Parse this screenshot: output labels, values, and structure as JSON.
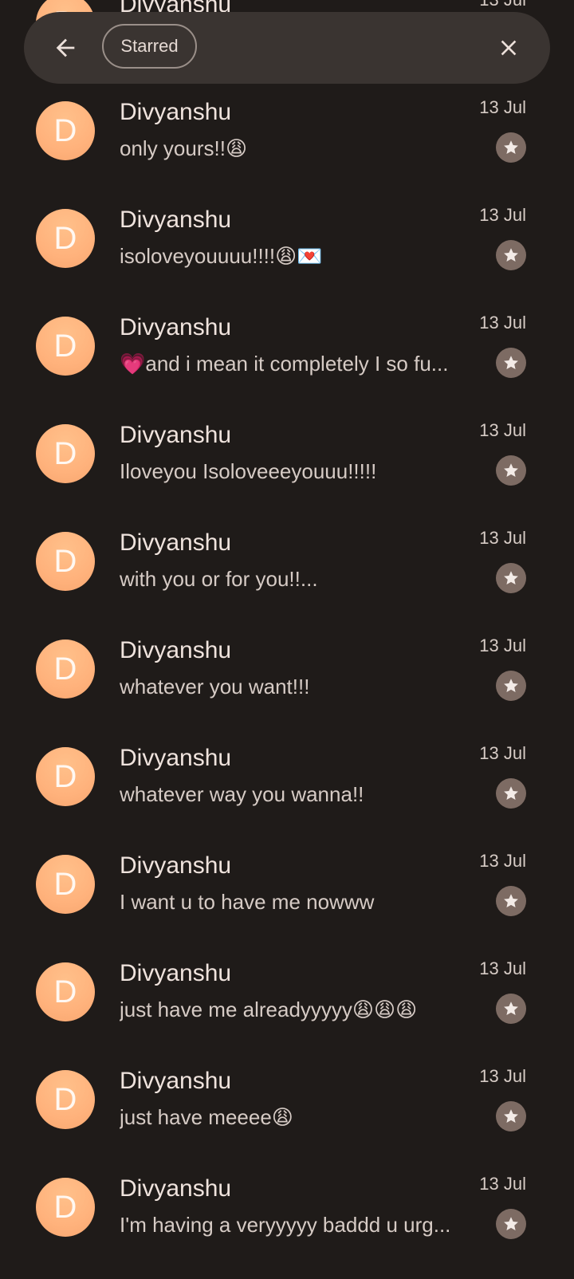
{
  "search_bar": {
    "filter_chip": "Starred",
    "back_icon": "arrow-back-icon",
    "close_icon": "close-icon"
  },
  "colors": {
    "background": "#1f1b19",
    "avatar": "#ffb27c",
    "star_badge": "#7d6b63",
    "search_bar": "#3a3431"
  },
  "messages": [
    {
      "initial": "D",
      "sender": "Divyanshu",
      "date": "13 Jul",
      "snippet": "",
      "starred": true
    },
    {
      "initial": "D",
      "sender": "Divyanshu",
      "date": "13 Jul",
      "snippet": "only yours!!😩",
      "starred": true
    },
    {
      "initial": "D",
      "sender": "Divyanshu",
      "date": "13 Jul",
      "snippet": "isoloveyouuuu!!!!😩💌",
      "starred": true
    },
    {
      "initial": "D",
      "sender": "Divyanshu",
      "date": "13 Jul",
      "snippet": "💗and i mean it completely I so fu...",
      "starred": true
    },
    {
      "initial": "D",
      "sender": "Divyanshu",
      "date": "13 Jul",
      "snippet": "Iloveyou Isoloveeeyouuu!!!!!",
      "starred": true
    },
    {
      "initial": "D",
      "sender": "Divyanshu",
      "date": "13 Jul",
      "snippet": "with you or for you!!...",
      "starred": true
    },
    {
      "initial": "D",
      "sender": "Divyanshu",
      "date": "13 Jul",
      "snippet": "whatever you want!!!",
      "starred": true
    },
    {
      "initial": "D",
      "sender": "Divyanshu",
      "date": "13 Jul",
      "snippet": "whatever way you wanna!!",
      "starred": true
    },
    {
      "initial": "D",
      "sender": "Divyanshu",
      "date": "13 Jul",
      "snippet": "I want u to have me nowww",
      "starred": true
    },
    {
      "initial": "D",
      "sender": "Divyanshu",
      "date": "13 Jul",
      "snippet": "just have me alreadyyyyy😩😩😩",
      "starred": true
    },
    {
      "initial": "D",
      "sender": "Divyanshu",
      "date": "13 Jul",
      "snippet": "just have meeee😩",
      "starred": true
    },
    {
      "initial": "D",
      "sender": "Divyanshu",
      "date": "13 Jul",
      "snippet": "I'm having a veryyyyy baddd u urg...",
      "starred": true
    }
  ]
}
